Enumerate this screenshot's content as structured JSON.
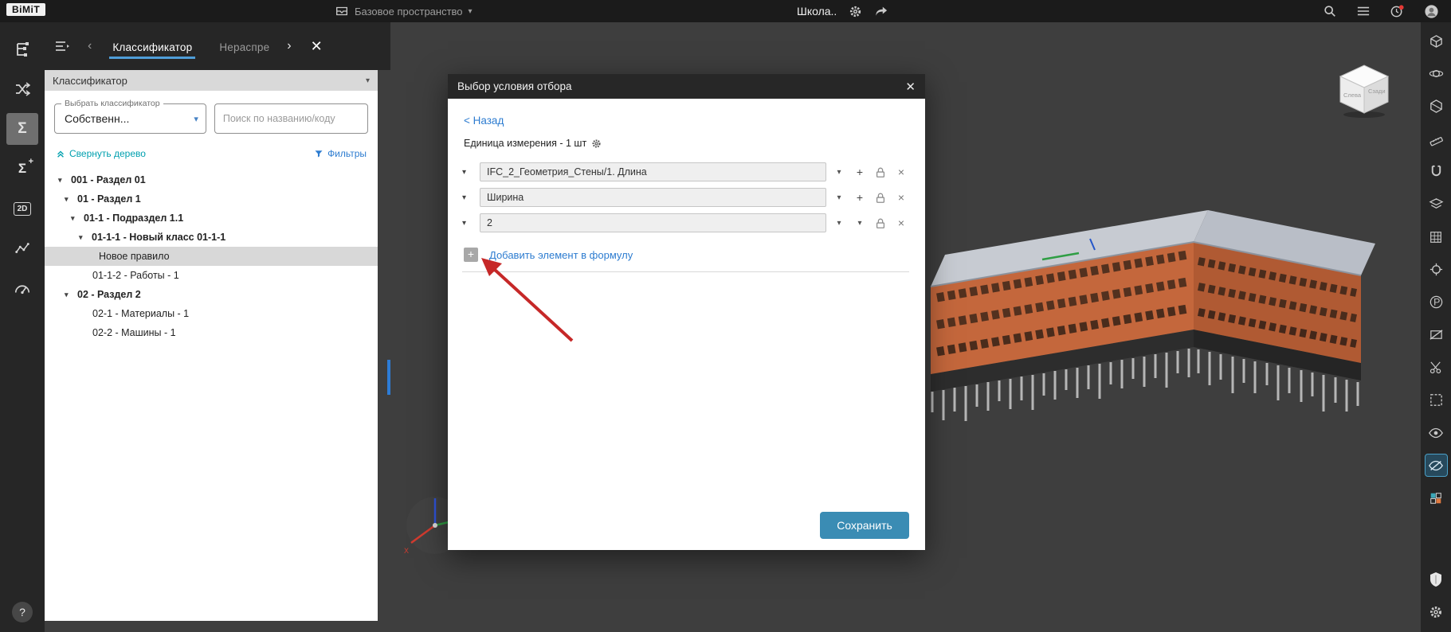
{
  "glyphs": {
    "caret_down": "▾",
    "close_x": "✕",
    "multiply_x": "×",
    "chevron_left": "‹",
    "chevron_right": "›",
    "plus": "+",
    "sigma": "Σ",
    "two_d": "2D",
    "help": "?",
    "x_axis": "X",
    "p_tool": "P"
  },
  "topbar": {
    "logo": "BiMiT",
    "workspace": "Базовое пространство",
    "project": "Школа.."
  },
  "tabs": {
    "classifier": "Классификатор",
    "unallocated": "Нераспре"
  },
  "panel": {
    "header": "Классификатор",
    "select_label": "Выбрать классификатор",
    "select_value": "Собственн...",
    "search_placeholder": "Поиск по названию/коду",
    "collapse_link": "Свернуть дерево",
    "filters_link": "Фильтры",
    "tree": [
      {
        "label": "001 - Раздел 01",
        "expanded": true
      },
      {
        "label": "01 - Раздел 1",
        "expanded": true
      },
      {
        "label": "01-1 - Подраздел 1.1",
        "expanded": true
      },
      {
        "label": "01-1-1 - Новый класс 01-1-1",
        "expanded": true
      },
      {
        "label": "Новое правило",
        "selected": true
      },
      {
        "label": "01-1-2 - Работы - 1"
      },
      {
        "label": "02 - Раздел 2",
        "expanded": true
      },
      {
        "label": "02-1 - Материалы - 1"
      },
      {
        "label": "02-2 - Машины - 1"
      }
    ]
  },
  "modal": {
    "title": "Выбор условия отбора",
    "back_link": "< Назад",
    "unit_text": "Единица измерения - 1 шт",
    "rows": [
      {
        "value": "IFC_2_Геометрия_Стены/1. Длина"
      },
      {
        "value": "Ширина"
      },
      {
        "value": "2"
      }
    ],
    "add_link": "Добавить элемент в формулу",
    "save_button": "Сохранить"
  },
  "viewport": {
    "cube_left_label": "Слева",
    "cube_right_label": "Сзади"
  },
  "colors": {
    "accent_blue": "#2d7cd0",
    "teal_link": "#00a0af",
    "save_button": "#3a8cb4",
    "arrow": "#c62828",
    "building": "#c4673c",
    "tab_underline": "#4f9ed8",
    "selection": "#d8d8d8"
  }
}
